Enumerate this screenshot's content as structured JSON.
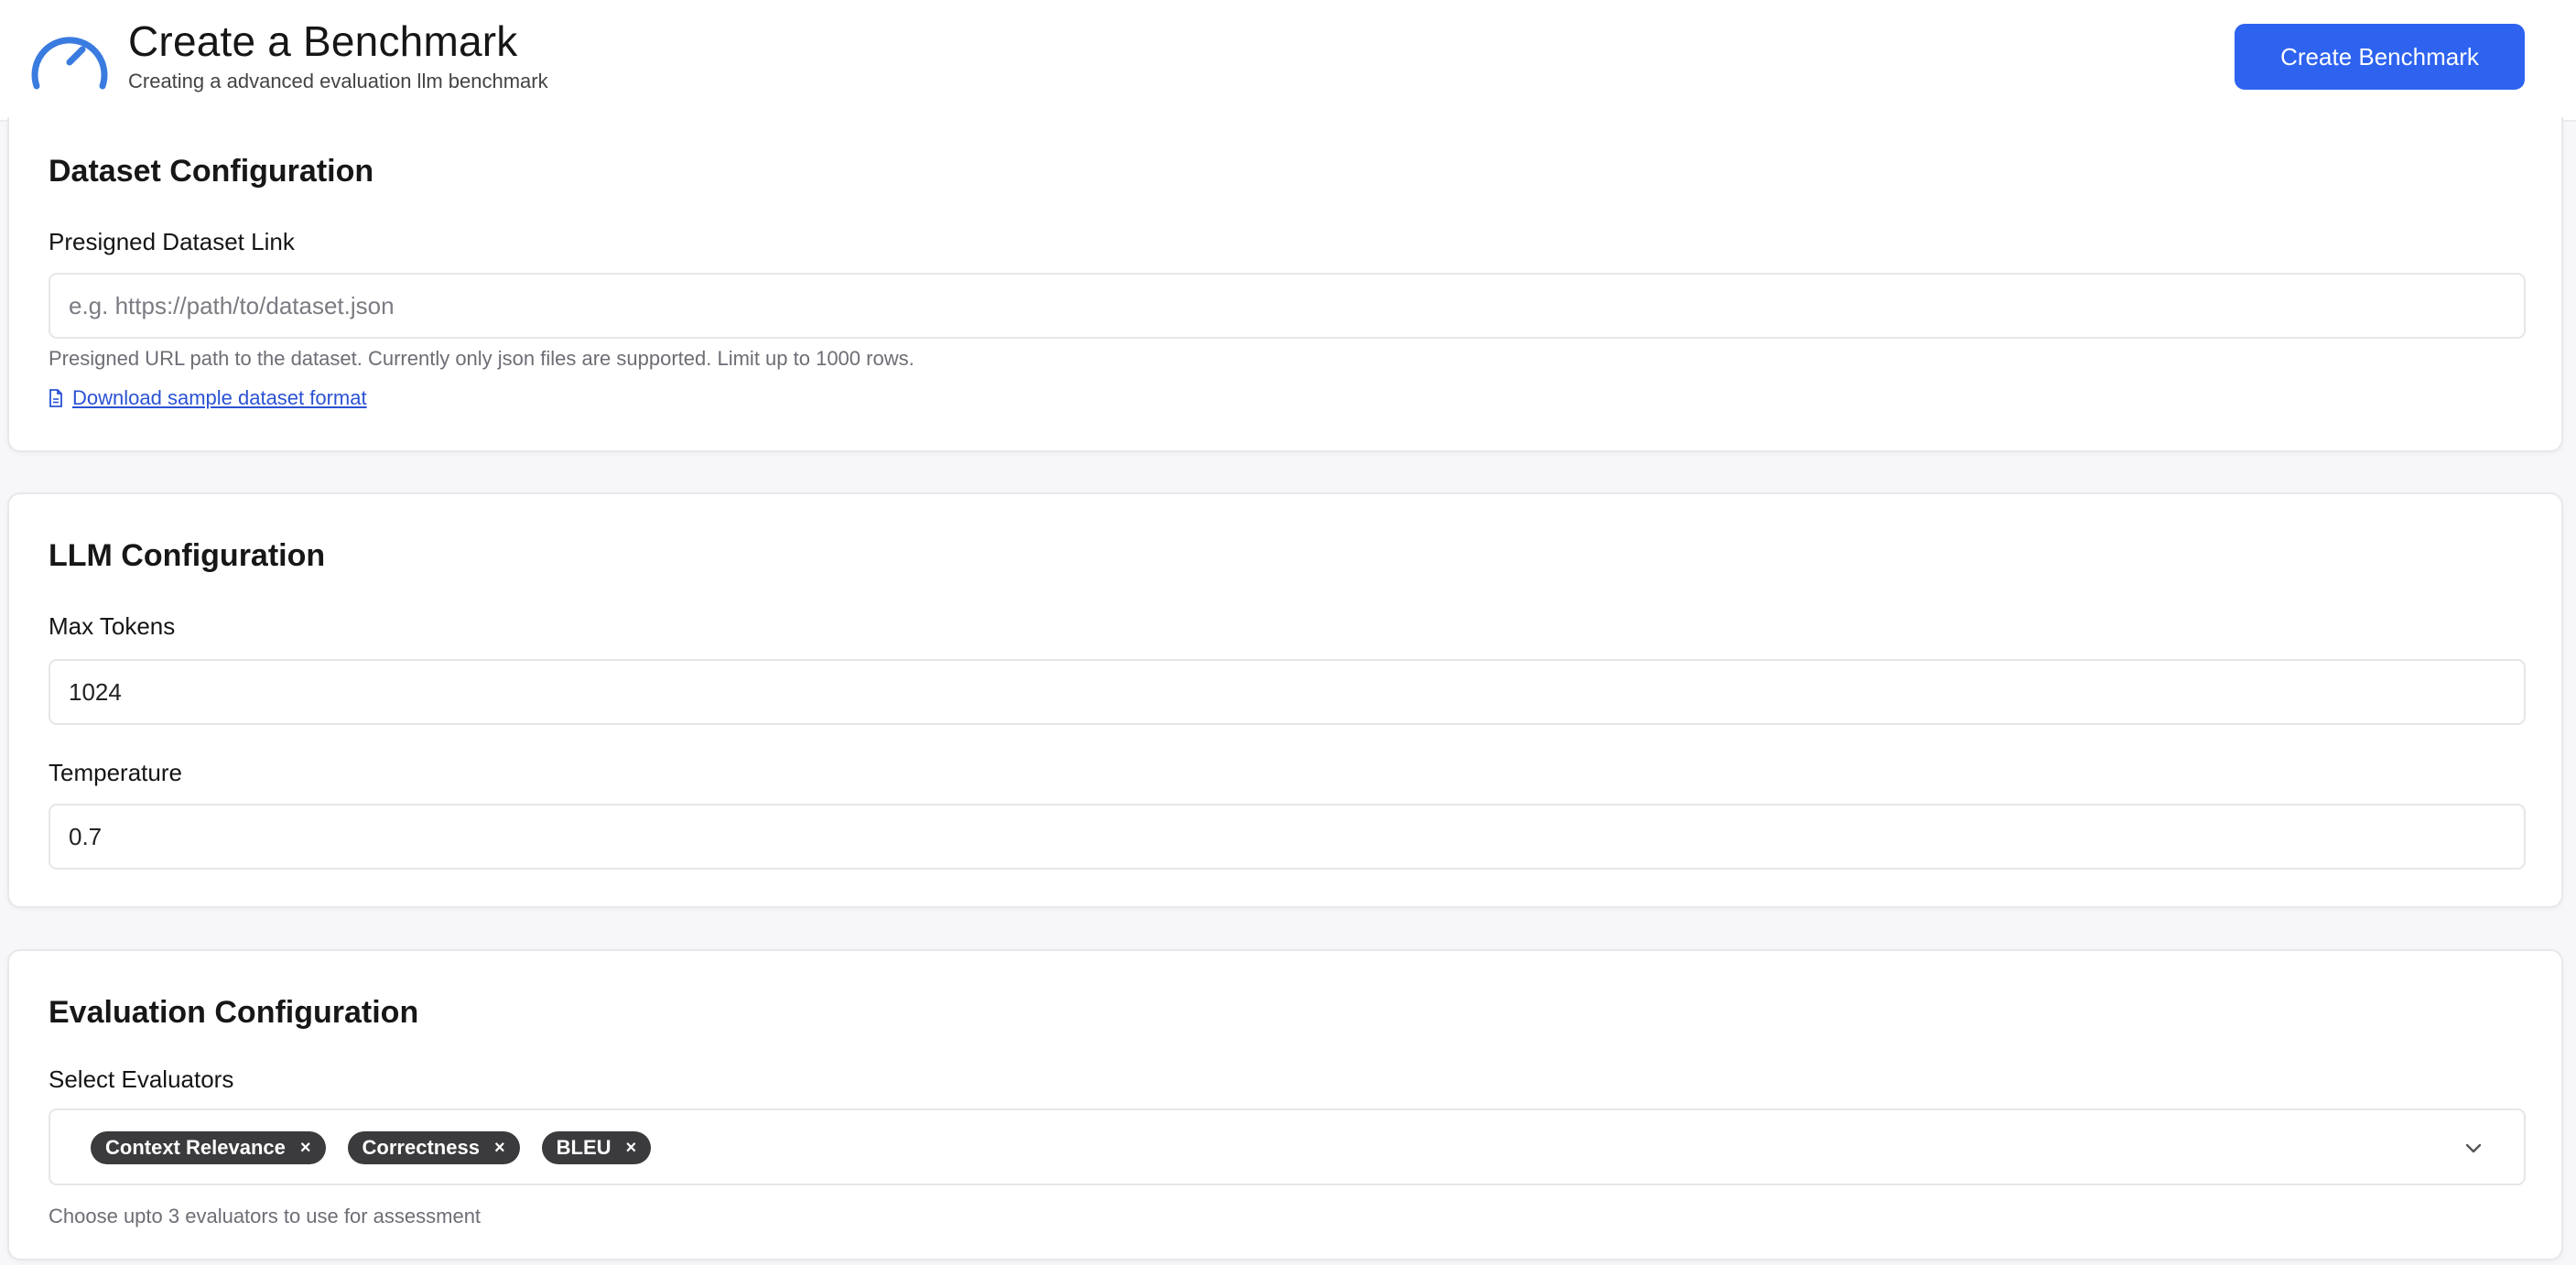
{
  "header": {
    "title": "Create a Benchmark",
    "subtitle": "Creating a advanced evaluation llm benchmark",
    "create_button": "Create Benchmark",
    "logo_icon": "gauge-icon",
    "accent_color": "#2e63f0"
  },
  "dataset": {
    "title": "Dataset Configuration",
    "link_label": "Presigned Dataset Link",
    "link_placeholder": "e.g. https://path/to/dataset.json",
    "link_value": "",
    "help": "Presigned URL path to the dataset. Currently only json files are supported. Limit up to 1000 rows.",
    "download_link": "Download sample dataset format",
    "download_icon": "file-icon"
  },
  "llm": {
    "title": "LLM Configuration",
    "max_tokens_label": "Max Tokens",
    "max_tokens_value": "1024",
    "temperature_label": "Temperature",
    "temperature_value": "0.7"
  },
  "evaluation": {
    "title": "Evaluation Configuration",
    "select_label": "Select Evaluators",
    "selected": [
      {
        "label": "Context Relevance",
        "remove": "×"
      },
      {
        "label": "Correctness",
        "remove": "×"
      },
      {
        "label": "BLEU",
        "remove": "×"
      }
    ],
    "help": "Choose upto 3 evaluators to use for assessment",
    "dropdown_icon": "chevron-down-icon"
  }
}
